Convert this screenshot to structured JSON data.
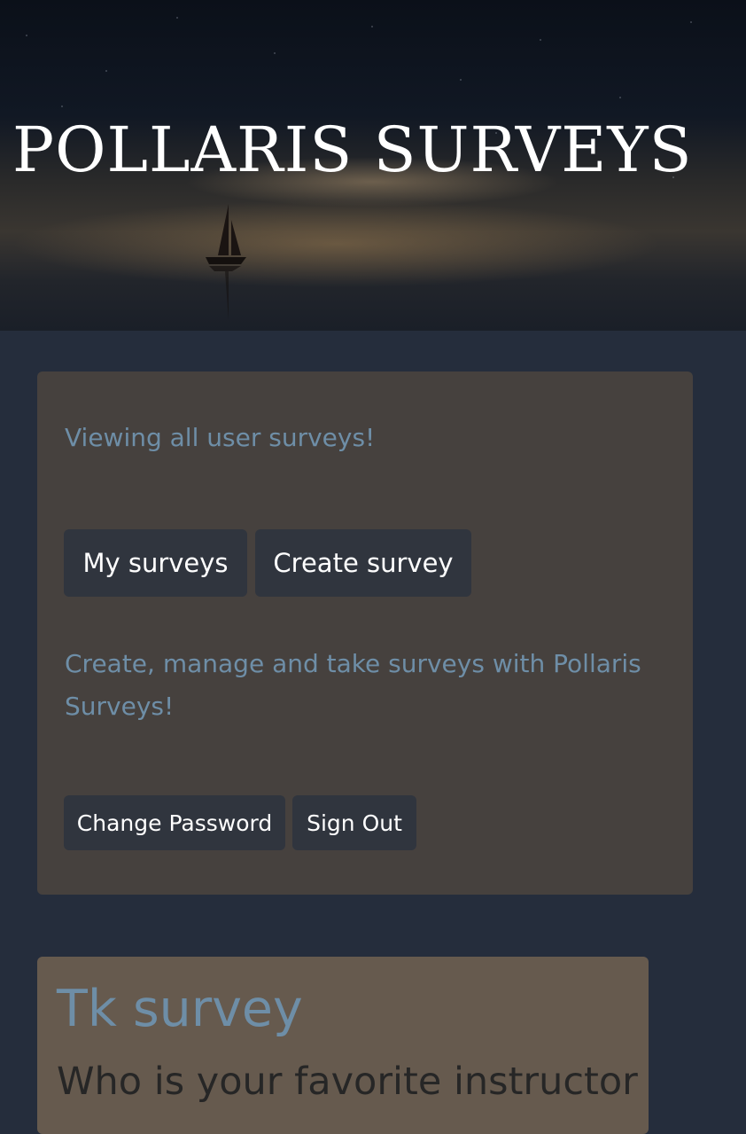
{
  "header": {
    "title": "POLLARIS SURVEYS"
  },
  "panel": {
    "viewing_text": "Viewing all user surveys!",
    "my_surveys_label": "My surveys",
    "create_survey_label": "Create survey",
    "tagline": "Create, manage and take surveys with Pollaris Surveys!",
    "change_password_label": "Change Password",
    "sign_out_label": "Sign Out"
  },
  "surveys": [
    {
      "title": "Tk survey",
      "question": "Who is your favorite instructor"
    }
  ],
  "colors": {
    "page_background": "#252d3c",
    "panel_background": "#46413e",
    "button_background": "#30353e",
    "accent_text": "#6e8ea7",
    "survey_card_background": "#665a4e"
  },
  "icons": {
    "hero_image": "sailboat-night-sky"
  }
}
